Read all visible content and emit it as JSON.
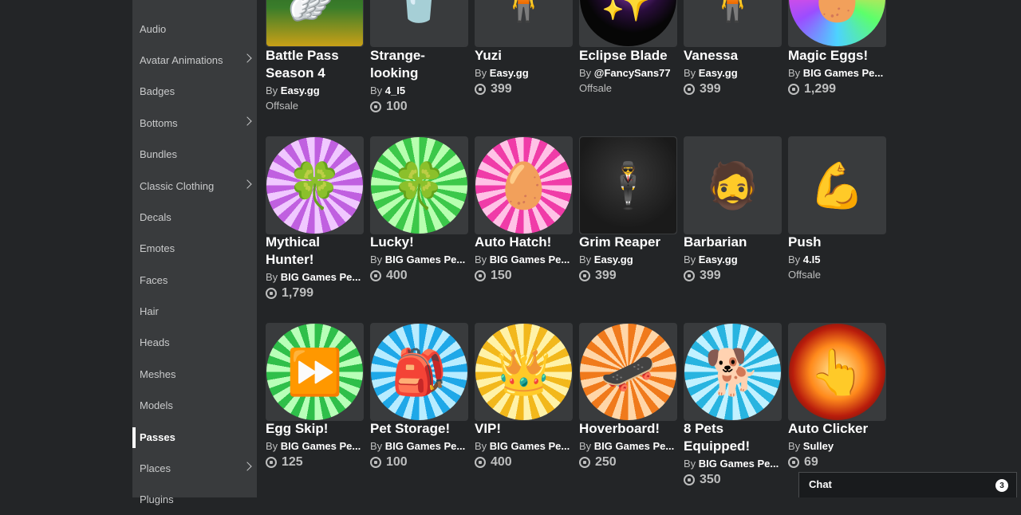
{
  "sidebar": {
    "items": [
      {
        "label": "Audio",
        "chevron": false
      },
      {
        "label": "Avatar Animations",
        "chevron": true
      },
      {
        "label": "Badges",
        "chevron": false
      },
      {
        "label": "Bottoms",
        "chevron": true
      },
      {
        "label": "Bundles",
        "chevron": false
      },
      {
        "label": "Classic Clothing",
        "chevron": true
      },
      {
        "label": "Decals",
        "chevron": false
      },
      {
        "label": "Emotes",
        "chevron": false
      },
      {
        "label": "Faces",
        "chevron": false
      },
      {
        "label": "Hair",
        "chevron": false
      },
      {
        "label": "Heads",
        "chevron": false
      },
      {
        "label": "Meshes",
        "chevron": false
      },
      {
        "label": "Models",
        "chevron": false
      },
      {
        "label": "Passes",
        "chevron": false,
        "active": true
      },
      {
        "label": "Places",
        "chevron": true
      },
      {
        "label": "Plugins",
        "chevron": false
      }
    ]
  },
  "items": [
    {
      "name": "Battle Pass\nSeason 4",
      "by_prefix": "By",
      "creator": "Easy.gg",
      "price": "",
      "status": "Offsale",
      "icon": "battle-pass-wings-icon"
    },
    {
      "name": "Strange-\nlooking",
      "by_prefix": "By",
      "creator": "4_I5",
      "price": "100",
      "status": "",
      "icon": "cup-icon"
    },
    {
      "name": "Yuzi",
      "by_prefix": "By",
      "creator": "Easy.gg",
      "price": "399",
      "status": "",
      "icon": "yuzi-avatar-icon"
    },
    {
      "name": "Eclipse Blade",
      "by_prefix": "By",
      "creator": "@FancySans77",
      "price": "",
      "status": "Offsale",
      "icon": "eclipse-blade-icon"
    },
    {
      "name": "Vanessa",
      "by_prefix": "By",
      "creator": "Easy.gg",
      "price": "399",
      "status": "",
      "icon": "vanessa-avatar-icon"
    },
    {
      "name": "Magic Eggs!",
      "by_prefix": "By",
      "creator": "BIG Games Pe...",
      "price": "1,299",
      "status": "",
      "icon": "magic-egg-icon"
    },
    {
      "name": "Mythical\nHunter!",
      "by_prefix": "By",
      "creator": "BIG Games Pe...",
      "price": "1,799",
      "status": "",
      "icon": "purple-clover-icon"
    },
    {
      "name": "Lucky!",
      "by_prefix": "By",
      "creator": "BIG Games Pe...",
      "price": "400",
      "status": "",
      "icon": "green-clover-icon"
    },
    {
      "name": "Auto Hatch!",
      "by_prefix": "By",
      "creator": "BIG Games Pe...",
      "price": "150",
      "status": "",
      "icon": "egg-hatch-icon"
    },
    {
      "name": "Grim Reaper",
      "by_prefix": "By",
      "creator": "Easy.gg",
      "price": "399",
      "status": "",
      "icon": "grim-reaper-icon"
    },
    {
      "name": "Barbarian",
      "by_prefix": "By",
      "creator": "Easy.gg",
      "price": "399",
      "status": "",
      "icon": "barbarian-avatar-icon"
    },
    {
      "name": "Push",
      "by_prefix": "By",
      "creator": "4.I5",
      "price": "",
      "status": "Offsale",
      "icon": "gold-arms-icon"
    },
    {
      "name": "Egg Skip!",
      "by_prefix": "By",
      "creator": "BIG Games Pe...",
      "price": "125",
      "status": "",
      "icon": "fast-forward-icon"
    },
    {
      "name": "Pet Storage!",
      "by_prefix": "By",
      "creator": "BIG Games Pe...",
      "price": "100",
      "status": "",
      "icon": "backpack-icon"
    },
    {
      "name": "VIP!",
      "by_prefix": "By",
      "creator": "BIG Games Pe...",
      "price": "400",
      "status": "",
      "icon": "vip-crown-icon"
    },
    {
      "name": "Hoverboard!",
      "by_prefix": "By",
      "creator": "BIG Games Pe...",
      "price": "250",
      "status": "",
      "icon": "hoverboard-icon"
    },
    {
      "name": "8 Pets\nEquipped!",
      "by_prefix": "By",
      "creator": "BIG Games Pe...",
      "price": "350",
      "status": "",
      "icon": "corgi-8-pets-icon"
    },
    {
      "name": "Auto Clicker",
      "by_prefix": "By",
      "creator": "Sulley",
      "price": "69",
      "status": "",
      "icon": "pointing-hand-icon"
    }
  ],
  "chat": {
    "label": "Chat",
    "badge": "3"
  }
}
